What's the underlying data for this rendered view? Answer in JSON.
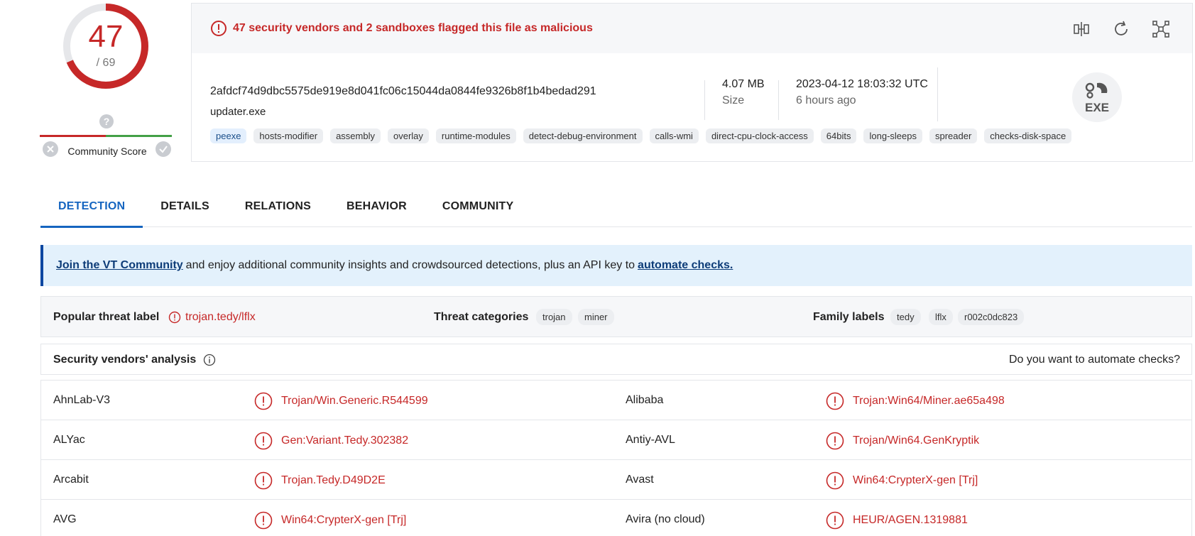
{
  "score": {
    "detected": "47",
    "total": "/ 69",
    "community_label": "Community Score"
  },
  "alert": {
    "text": "47 security vendors and 2 sandboxes flagged this file as malicious"
  },
  "file": {
    "hash": "2afdcf74d9dbc5575de919e8d041fc06c15044da0844fe9326b8f1b4bedad291",
    "name": "updater.exe",
    "size_value": "4.07 MB",
    "size_label": "Size",
    "date_value": "2023-04-12 18:03:32 UTC",
    "date_relative": "6 hours ago",
    "type_badge": "EXE"
  },
  "tags": [
    "peexe",
    "hosts-modifier",
    "assembly",
    "overlay",
    "runtime-modules",
    "detect-debug-environment",
    "calls-wmi",
    "direct-cpu-clock-access",
    "64bits",
    "long-sleeps",
    "spreader",
    "checks-disk-space"
  ],
  "tabs": [
    "DETECTION",
    "DETAILS",
    "RELATIONS",
    "BEHAVIOR",
    "COMMUNITY"
  ],
  "banner": {
    "link1": "Join the VT Community",
    "middle": "and enjoy additional community insights and crowdsourced detections, plus an API key to",
    "link2": "automate checks."
  },
  "threat": {
    "popular_label": "Popular threat label",
    "popular_value": "trojan.tedy/lflx",
    "categories_label": "Threat categories",
    "categories": [
      "trojan",
      "miner"
    ],
    "family_label": "Family labels",
    "families": [
      "tedy",
      "lflx",
      "r002c0dc823"
    ]
  },
  "vendors": {
    "title": "Security vendors' analysis",
    "automate": "Do you want to automate checks?",
    "rows": [
      {
        "left_name": "AhnLab-V3",
        "left_result": "Trojan/Win.Generic.R544599",
        "right_name": "Alibaba",
        "right_result": "Trojan:Win64/Miner.ae65a498"
      },
      {
        "left_name": "ALYac",
        "left_result": "Gen:Variant.Tedy.302382",
        "right_name": "Antiy-AVL",
        "right_result": "Trojan/Win64.GenKryptik"
      },
      {
        "left_name": "Arcabit",
        "left_result": "Trojan.Tedy.D49D2E",
        "right_name": "Avast",
        "right_result": "Win64:CrypterX-gen [Trj]"
      },
      {
        "left_name": "AVG",
        "left_result": "Win64:CrypterX-gen [Trj]",
        "right_name": "Avira (no cloud)",
        "right_result": "HEUR/AGEN.1319881"
      }
    ]
  },
  "colors": {
    "malicious": "#c62828",
    "accent": "#1565c0",
    "banner_bg": "#e3f1fc"
  }
}
